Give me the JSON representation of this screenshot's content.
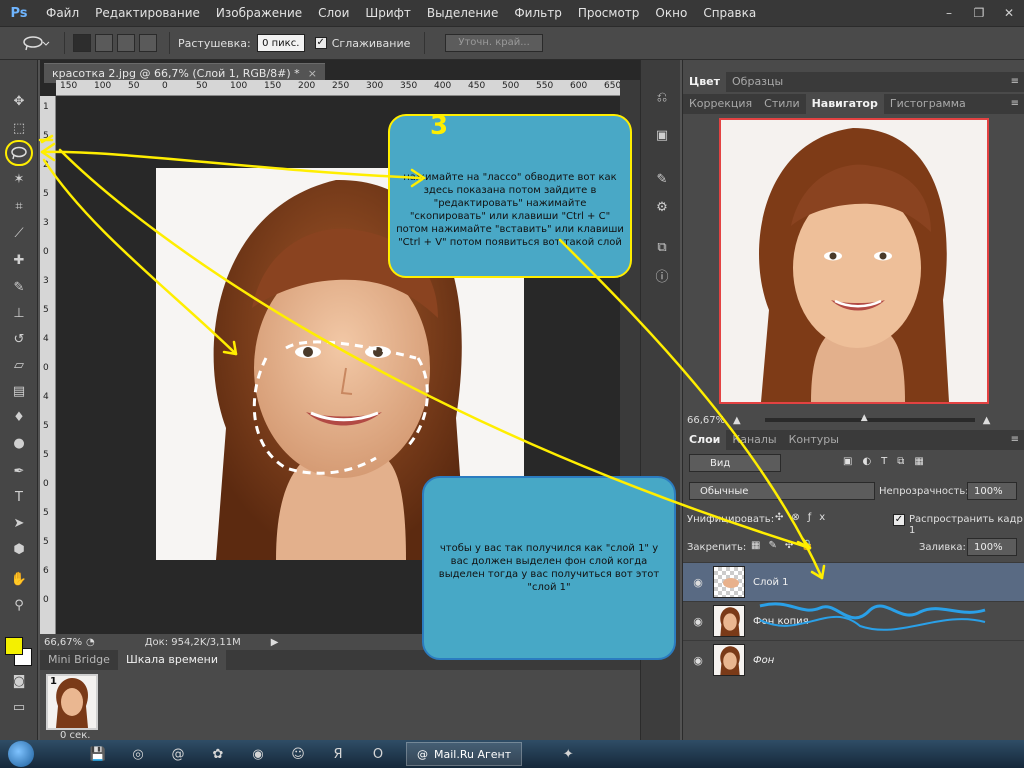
{
  "app": {
    "logo": "Ps"
  },
  "menu": [
    "Файл",
    "Редактирование",
    "Изображение",
    "Слои",
    "Шрифт",
    "Выделение",
    "Фильтр",
    "Просмотр",
    "Окно",
    "Справка"
  ],
  "window_controls": {
    "minimize": "–",
    "restore": "❐",
    "close": "✕"
  },
  "options": {
    "feather_label": "Растушевка:",
    "feather_value": "0 пикс.",
    "antialias_label": "Сглаживание",
    "antialias_checked": "✓",
    "refine_label": "Уточн. край..."
  },
  "document": {
    "tab_title": "красотка 2.jpg @ 66,7% (Слой 1, RGB/8#) *",
    "tab_close": "×",
    "ruler_h": [
      "150",
      "100",
      "50",
      "0",
      "50",
      "100",
      "150",
      "200",
      "250",
      "300",
      "350",
      "400",
      "450",
      "500",
      "550",
      "600",
      "650"
    ],
    "ruler_v": [
      "1",
      "5",
      "2",
      "5",
      "3",
      "0",
      "3",
      "5",
      "4",
      "0",
      "4",
      "5",
      "5",
      "0",
      "5",
      "5",
      "6",
      "0"
    ],
    "zoom": "66,67%",
    "doc_info": "Док: 954,2K/3,11M"
  },
  "bottom_panel": {
    "tabs": [
      "Mini Bridge",
      "Шкала времени"
    ],
    "frame_number": "1",
    "frame_time": "0 сек."
  },
  "right_top": {
    "tabs1": [
      "Цвет",
      "Образцы"
    ],
    "tabs2": [
      "Коррекция",
      "Стили",
      "Навигатор",
      "Гистограмма"
    ],
    "nav_zoom": "66,67%"
  },
  "layers": {
    "tabs": [
      "Слои",
      "Каналы",
      "Контуры"
    ],
    "kind_label": "Вид",
    "blend_mode": "Обычные",
    "opacity_label": "Непрозрачность:",
    "opacity_value": "100%",
    "unify_label": "Унифицировать:",
    "propagate_label": "Распространить кадр 1",
    "lock_label": "Закрепить:",
    "fill_label": "Заливка:",
    "fill_value": "100%",
    "items": [
      {
        "name": "Слой 1",
        "selected": true
      },
      {
        "name": "Фон копия",
        "selected": false
      },
      {
        "name": "Фон",
        "selected": false
      }
    ]
  },
  "annotations": {
    "step_number": "3",
    "callout1": "нажимайте на \"лассо\" обводите вот как здесь показана потом зайдите в \"редактировать\" нажимайте \"скопировать\" или клавиши \"Ctrl + C\" потом нажимайте \"вставить\" или клавиши \"Ctrl + V\" потом появиться вот такой слой",
    "callout2": "чтобы у вас так получился как \"слой 1\" у вас должен выделен фон слой когда выделен тогда у вас получиться вот этот \"слой 1\""
  },
  "taskbar": {
    "app_label": "Mail.Ru Агент",
    "icons": [
      "save-icon",
      "chrome-icon",
      "mail-agent-icon",
      "icq-icon",
      "firefox-icon",
      "odnoklassniki-icon",
      "yandex-icon",
      "opera-icon",
      "paint-icon"
    ]
  },
  "colors": {
    "foreground": "#f4f000",
    "background": "#ffffff",
    "annotation_yellow": "#ffee00",
    "callout_fill": "#49a8c6",
    "selected_layer": "#596a83"
  }
}
